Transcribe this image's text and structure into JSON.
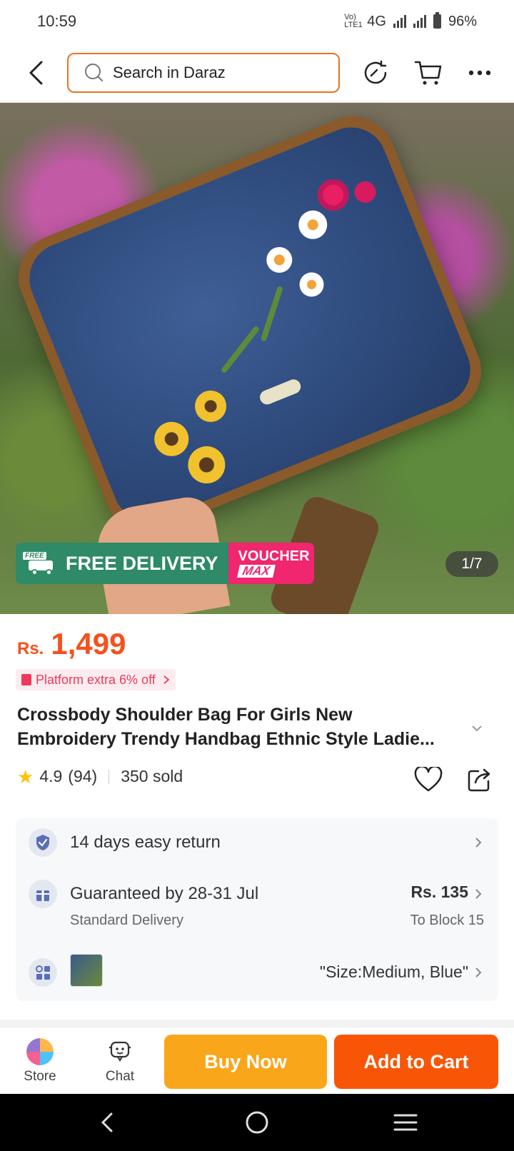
{
  "status_bar": {
    "time": "10:59",
    "network": "4G",
    "volte": "Vo) LTE1",
    "battery": "96%"
  },
  "header": {
    "search_placeholder": "Search in Daraz"
  },
  "product": {
    "image_counter": "1/7",
    "promo": {
      "free_tag": "FREE",
      "free_delivery": "FREE DELIVERY",
      "voucher_line1": "VOUCHER",
      "voucher_line2": "MAX"
    },
    "price_currency": "Rs.",
    "price_value": "1,499",
    "platform_offer": "Platform extra 6% off",
    "title_line1": "Crossbody Shoulder Bag For Girls New",
    "title_line2": "Embroidery Trendy Handbag Ethnic Style Ladie...",
    "rating": "4.9",
    "review_count": "(94)",
    "sold": "350 sold"
  },
  "services": {
    "return": {
      "label": "14 days easy return"
    },
    "delivery": {
      "label": "Guaranteed by 28-31 Jul",
      "sub": "Standard Delivery",
      "price": "Rs. 135",
      "destination": "To Block 15"
    },
    "variant": {
      "label": "\"Size:Medium, Blue\""
    }
  },
  "bottom_bar": {
    "store": "Store",
    "chat": "Chat",
    "buy_now": "Buy Now",
    "add_to_cart": "Add to Cart"
  },
  "colors": {
    "brand_orange": "#f85606",
    "buy_yellow": "#faa61a",
    "price_orange": "#f4511e",
    "promo_green": "#2e8a67",
    "promo_pink": "#f0266e"
  },
  "icons": [
    "back-icon",
    "search-icon",
    "history-icon",
    "cart-icon",
    "more-icon",
    "truck-icon",
    "star-icon",
    "heart-icon",
    "share-icon",
    "shield-icon",
    "gift-icon",
    "grid-icon",
    "store-icon",
    "chat-icon",
    "nav-back-icon",
    "nav-home-icon",
    "nav-menu-icon"
  ]
}
